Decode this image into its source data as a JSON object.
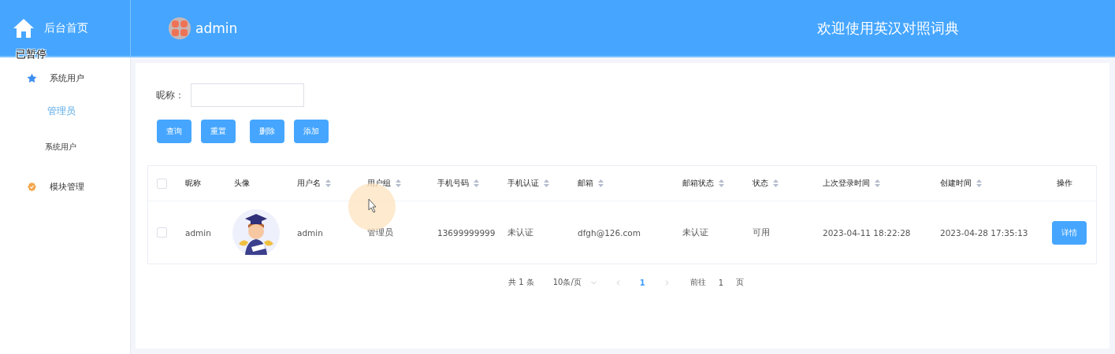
{
  "header": {
    "home_label": "后台首页",
    "user": "admin",
    "title": "欢迎使用英汉对照词典"
  },
  "overlay_text": "已暂停",
  "sidebar": {
    "menu": [
      {
        "label": "系统用户",
        "children": [
          {
            "label": "管理员",
            "selected": true
          },
          {
            "label": "系统用户",
            "selected": false
          }
        ]
      },
      {
        "label": "模块管理"
      }
    ]
  },
  "search": {
    "label": "昵称："
  },
  "buttons": [
    "查询",
    "重置",
    "删除",
    "添加"
  ],
  "table": {
    "select_all": {
      "checked": false
    },
    "columns": [
      {
        "label": "昵称",
        "sortable": false
      },
      {
        "label": "头像",
        "sortable": false
      },
      {
        "label": "用户名",
        "sortable": true
      },
      {
        "label": "用户组",
        "sortable": true
      },
      {
        "label": "手机号码",
        "sortable": true
      },
      {
        "label": "手机认证",
        "sortable": true
      },
      {
        "label": "邮箱",
        "sortable": true
      },
      {
        "label": "邮箱状态",
        "sortable": true
      },
      {
        "label": "状态",
        "sortable": true
      },
      {
        "label": "上次登录时间",
        "sortable": true
      },
      {
        "label": "创建时间",
        "sortable": true
      },
      {
        "label": "操作",
        "sortable": false
      }
    ],
    "rows": [
      {
        "checked": false,
        "cells": [
          {
            "kind": "text",
            "text": "admin"
          },
          {
            "kind": "avatar"
          },
          {
            "kind": "text",
            "text": "admin"
          },
          {
            "kind": "text",
            "text": "管理员"
          },
          {
            "kind": "text",
            "text": "13699999999"
          },
          {
            "kind": "text",
            "text": "未认证"
          },
          {
            "kind": "text",
            "text": "dfgh@126.com"
          },
          {
            "kind": "text",
            "text": "未认证"
          },
          {
            "kind": "text",
            "text": "可用"
          },
          {
            "kind": "text",
            "text": "2023-04-11 18:22:28"
          },
          {
            "kind": "text",
            "text": "2023-04-28 17:35:13"
          },
          {
            "kind": "button",
            "text": "详情"
          }
        ]
      }
    ]
  },
  "pagination": {
    "total": "共 1 条",
    "page_size": "10条/页",
    "pages": [
      {
        "label": "1",
        "selected": true
      }
    ],
    "goto_label": "前往",
    "goto_value": "1",
    "page_suffix": "页"
  }
}
